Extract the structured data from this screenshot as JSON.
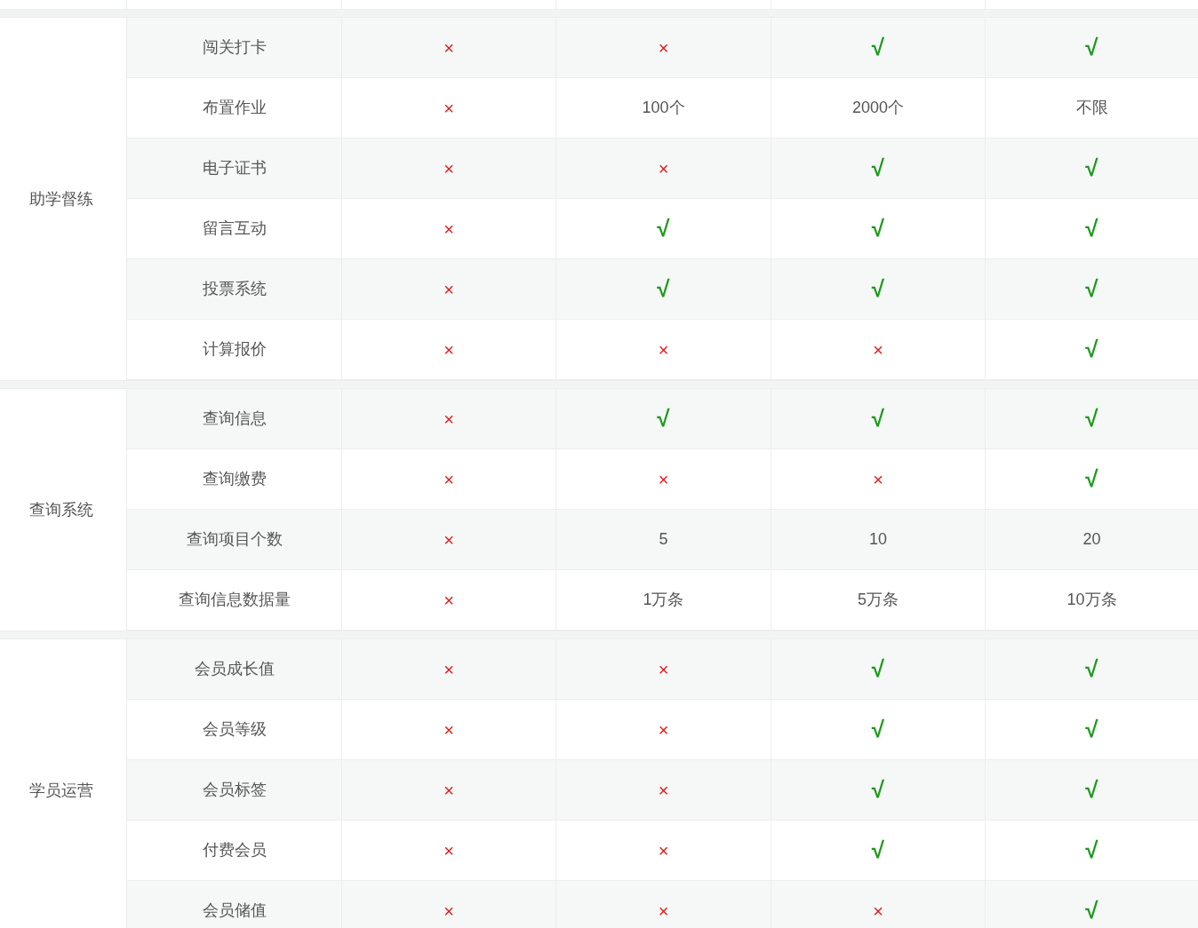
{
  "groups": [
    {
      "label": "助学督练",
      "rows": [
        {
          "feature": "闯关打卡",
          "cells": [
            {
              "kind": "cross",
              "text": "×"
            },
            {
              "kind": "cross",
              "text": "×"
            },
            {
              "kind": "check",
              "text": "√"
            },
            {
              "kind": "check",
              "text": "√"
            }
          ]
        },
        {
          "feature": "布置作业",
          "cells": [
            {
              "kind": "cross",
              "text": "×"
            },
            {
              "kind": "text",
              "text": "100个"
            },
            {
              "kind": "text",
              "text": "2000个"
            },
            {
              "kind": "text",
              "text": "不限"
            }
          ]
        },
        {
          "feature": "电子证书",
          "cells": [
            {
              "kind": "cross",
              "text": "×"
            },
            {
              "kind": "cross",
              "text": "×"
            },
            {
              "kind": "check",
              "text": "√"
            },
            {
              "kind": "check",
              "text": "√"
            }
          ]
        },
        {
          "feature": "留言互动",
          "cells": [
            {
              "kind": "cross",
              "text": "×"
            },
            {
              "kind": "check",
              "text": "√"
            },
            {
              "kind": "check",
              "text": "√"
            },
            {
              "kind": "check",
              "text": "√"
            }
          ]
        },
        {
          "feature": "投票系统",
          "cells": [
            {
              "kind": "cross",
              "text": "×"
            },
            {
              "kind": "check",
              "text": "√"
            },
            {
              "kind": "check",
              "text": "√"
            },
            {
              "kind": "check",
              "text": "√"
            }
          ]
        },
        {
          "feature": "计算报价",
          "cells": [
            {
              "kind": "cross",
              "text": "×"
            },
            {
              "kind": "cross",
              "text": "×"
            },
            {
              "kind": "cross",
              "text": "×"
            },
            {
              "kind": "check",
              "text": "√"
            }
          ]
        }
      ]
    },
    {
      "label": "查询系统",
      "rows": [
        {
          "feature": "查询信息",
          "cells": [
            {
              "kind": "cross",
              "text": "×"
            },
            {
              "kind": "check",
              "text": "√"
            },
            {
              "kind": "check",
              "text": "√"
            },
            {
              "kind": "check",
              "text": "√"
            }
          ]
        },
        {
          "feature": "查询缴费",
          "cells": [
            {
              "kind": "cross",
              "text": "×"
            },
            {
              "kind": "cross",
              "text": "×"
            },
            {
              "kind": "cross",
              "text": "×"
            },
            {
              "kind": "check",
              "text": "√"
            }
          ]
        },
        {
          "feature": "查询项目个数",
          "cells": [
            {
              "kind": "cross",
              "text": "×"
            },
            {
              "kind": "text",
              "text": "5"
            },
            {
              "kind": "text",
              "text": "10"
            },
            {
              "kind": "text",
              "text": "20"
            }
          ]
        },
        {
          "feature": "查询信息数据量",
          "cells": [
            {
              "kind": "cross",
              "text": "×"
            },
            {
              "kind": "text",
              "text": "1万条"
            },
            {
              "kind": "text",
              "text": "5万条"
            },
            {
              "kind": "text",
              "text": "10万条"
            }
          ]
        }
      ]
    },
    {
      "label": "学员运营",
      "rows": [
        {
          "feature": "会员成长值",
          "cells": [
            {
              "kind": "cross",
              "text": "×"
            },
            {
              "kind": "cross",
              "text": "×"
            },
            {
              "kind": "check",
              "text": "√"
            },
            {
              "kind": "check",
              "text": "√"
            }
          ]
        },
        {
          "feature": "会员等级",
          "cells": [
            {
              "kind": "cross",
              "text": "×"
            },
            {
              "kind": "cross",
              "text": "×"
            },
            {
              "kind": "check",
              "text": "√"
            },
            {
              "kind": "check",
              "text": "√"
            }
          ]
        },
        {
          "feature": "会员标签",
          "cells": [
            {
              "kind": "cross",
              "text": "×"
            },
            {
              "kind": "cross",
              "text": "×"
            },
            {
              "kind": "check",
              "text": "√"
            },
            {
              "kind": "check",
              "text": "√"
            }
          ]
        },
        {
          "feature": "付费会员",
          "cells": [
            {
              "kind": "cross",
              "text": "×"
            },
            {
              "kind": "cross",
              "text": "×"
            },
            {
              "kind": "check",
              "text": "√"
            },
            {
              "kind": "check",
              "text": "√"
            }
          ]
        },
        {
          "feature": "会员储值",
          "cells": [
            {
              "kind": "cross",
              "text": "×"
            },
            {
              "kind": "cross",
              "text": "×"
            },
            {
              "kind": "cross",
              "text": "×"
            },
            {
              "kind": "check",
              "text": "√"
            }
          ]
        }
      ]
    }
  ]
}
